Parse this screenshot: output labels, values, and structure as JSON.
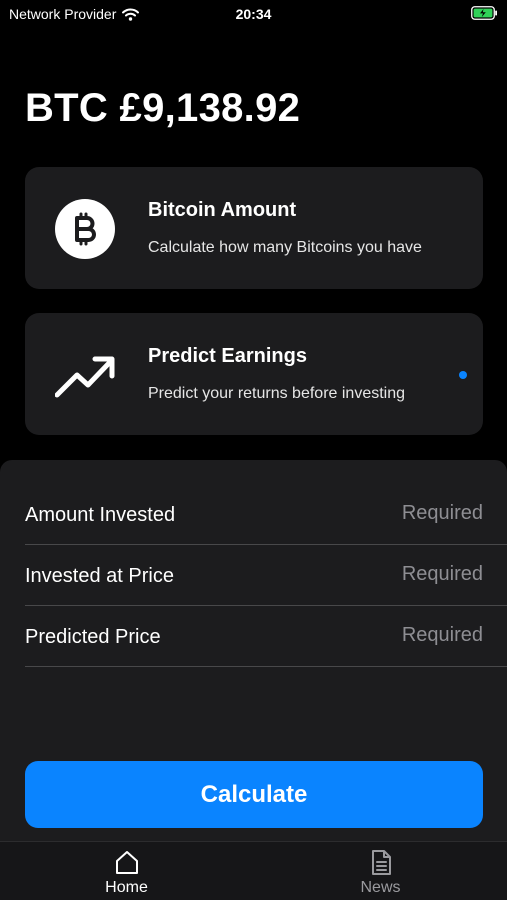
{
  "status": {
    "carrier": "Network Provider",
    "time": "20:34",
    "icons": [
      "wifi-icon",
      "battery-charging-icon"
    ]
  },
  "header": {
    "price": "BTC £9,138.92"
  },
  "cards": [
    {
      "icon": "bitcoin-icon",
      "title": "Bitcoin Amount",
      "subtitle": "Calculate how many Bitcoins you have",
      "selected": false
    },
    {
      "icon": "trending-up-icon",
      "title": "Predict Earnings",
      "subtitle": "Predict your returns before investing",
      "selected": true
    }
  ],
  "form": {
    "fields": [
      {
        "label": "Amount Invested",
        "placeholder": "Required",
        "value": ""
      },
      {
        "label": "Invested at Price",
        "placeholder": "Required",
        "value": ""
      },
      {
        "label": "Predicted Price",
        "placeholder": "Required",
        "value": ""
      }
    ],
    "submit_label": "Calculate"
  },
  "tabs": [
    {
      "label": "Home",
      "icon": "home-icon",
      "active": true
    },
    {
      "label": "News",
      "icon": "document-icon",
      "active": false
    }
  ],
  "colors": {
    "accent": "#0a84ff",
    "card_bg": "#1c1c1e",
    "background": "#000000",
    "battery_green": "#30d158"
  }
}
